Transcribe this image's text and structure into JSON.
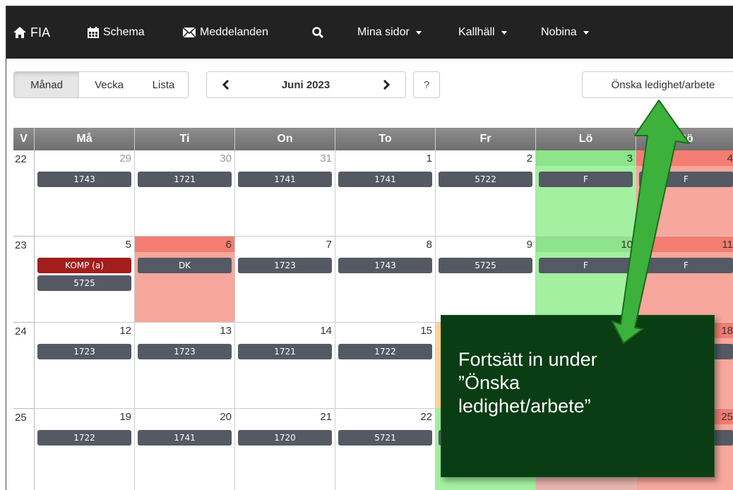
{
  "navbar": {
    "brand": "FIA",
    "items": [
      {
        "label": "Schema"
      },
      {
        "label": "Meddelanden"
      },
      {
        "label": "Mina sidor"
      },
      {
        "label": "Kallhäll"
      },
      {
        "label": "Nobina"
      }
    ]
  },
  "toolbar": {
    "view_buttons": [
      "Månad",
      "Vecka",
      "Lista"
    ],
    "active_view": "Månad",
    "month_label": "Juni 2023",
    "help_label": "?",
    "request_button": "Önska ledighet/arbete"
  },
  "calendar": {
    "week_header": "V",
    "day_headers": [
      "Må",
      "Ti",
      "On",
      "To",
      "Fr",
      "Lö",
      "Sö"
    ],
    "weeks": [
      {
        "number": "22",
        "days": [
          {
            "date": "29",
            "events": [
              "1743"
            ]
          },
          {
            "date": "30",
            "events": [
              "1721"
            ]
          },
          {
            "date": "31",
            "events": [
              "1741"
            ]
          },
          {
            "date": "1",
            "events": [
              "1741"
            ]
          },
          {
            "date": "2",
            "events": [
              "5722"
            ]
          },
          {
            "date": "3",
            "events": [
              "F"
            ]
          },
          {
            "date": "4",
            "events": [
              "F"
            ]
          }
        ]
      },
      {
        "number": "23",
        "days": [
          {
            "date": "5",
            "events": [
              "KOMP (a)",
              "5725"
            ]
          },
          {
            "date": "6",
            "events": [
              "DK"
            ]
          },
          {
            "date": "7",
            "events": [
              "1723"
            ]
          },
          {
            "date": "8",
            "events": [
              "1743"
            ]
          },
          {
            "date": "9",
            "events": [
              "5725"
            ]
          },
          {
            "date": "10",
            "events": [
              "F"
            ]
          },
          {
            "date": "11",
            "events": [
              "F"
            ]
          }
        ]
      },
      {
        "number": "24",
        "days": [
          {
            "date": "12",
            "events": [
              "1723"
            ]
          },
          {
            "date": "13",
            "events": [
              "1723"
            ]
          },
          {
            "date": "14",
            "events": [
              "1721"
            ]
          },
          {
            "date": "15",
            "events": [
              "1722"
            ]
          },
          {
            "date": "",
            "events": []
          },
          {
            "date": "",
            "events": []
          },
          {
            "date": "18",
            "events": []
          }
        ]
      },
      {
        "number": "25",
        "days": [
          {
            "date": "19",
            "events": [
              "1722"
            ]
          },
          {
            "date": "20",
            "events": [
              "1741"
            ]
          },
          {
            "date": "21",
            "events": [
              "1720"
            ]
          },
          {
            "date": "22",
            "events": [
              "5721"
            ]
          },
          {
            "date": "",
            "events": []
          },
          {
            "date": "",
            "events": []
          },
          {
            "date": "25",
            "events": []
          }
        ]
      }
    ]
  },
  "callout": {
    "line1": "Fortsätt in under",
    "line2": "”Önska",
    "line3": "ledighet/arbete”"
  },
  "colors": {
    "navbar": "#222222",
    "event": "#545964",
    "komp": "#a31d1d",
    "weekend_sat": "#a3f0a0",
    "weekend_sun": "#f7a79c",
    "callout": "#0a3d13",
    "arrow": "#3cb13c"
  }
}
